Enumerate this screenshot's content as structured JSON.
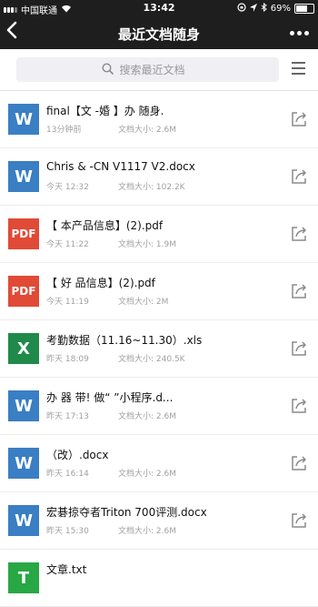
{
  "status_bar": {
    "carrier": "中国联通",
    "time": "13:42",
    "battery": "69%"
  },
  "nav": {
    "title": "最近文档随身"
  },
  "search": {
    "placeholder": "搜索最近文档"
  },
  "size_label": "文档大小:",
  "files": [
    {
      "icon": "W",
      "type": "word",
      "name": "final【文    -婚      】办      随身.",
      "time": "13分钟前",
      "size": "2.6M"
    },
    {
      "icon": "W",
      "type": "word",
      "name": "Chris     &     -CN V1117 V2.docx",
      "time": "今天 12:32",
      "size": "102.2K"
    },
    {
      "icon": "PDF",
      "type": "pdf",
      "name": "【           本产品信息】(2).pdf",
      "time": "今天 11:22",
      "size": "1.9M"
    },
    {
      "icon": "PDF",
      "type": "pdf",
      "name": "【      好    品信息】(2).pdf",
      "time": "今天 11:19",
      "size": "2M"
    },
    {
      "icon": "X",
      "type": "excel",
      "name": "考勤数据（11.16~11.30）.xls",
      "time": "昨天 18:09",
      "size": "240.5K"
    },
    {
      "icon": "W",
      "type": "word",
      "name": "办     器     带!      做“         ”小程序.d...",
      "time": "昨天 17:13",
      "size": "2.6M"
    },
    {
      "icon": "W",
      "type": "word",
      "name": "          （改）.docx",
      "time": "昨天 16:14",
      "size": "2.6M"
    },
    {
      "icon": "W",
      "type": "word",
      "name": "宏碁掠夺者Triton 700评测.docx",
      "time": "昨天 15:30",
      "size": "2.6M"
    },
    {
      "icon": "T",
      "type": "txt",
      "name": "文章.txt",
      "time": "",
      "size": ""
    }
  ]
}
